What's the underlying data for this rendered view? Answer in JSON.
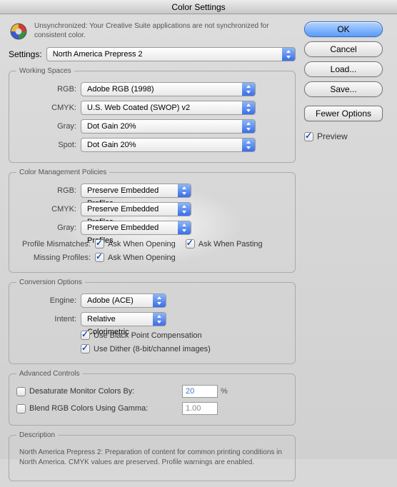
{
  "title": "Color Settings",
  "sync_msg": "Unsynchronized: Your Creative Suite applications are not synchronized for consistent color.",
  "settings_label": "Settings:",
  "settings_preset": "North America Prepress 2",
  "working_spaces": {
    "legend": "Working Spaces",
    "rgb_label": "RGB:",
    "rgb_value": "Adobe RGB (1998)",
    "cmyk_label": "CMYK:",
    "cmyk_value": "U.S. Web Coated (SWOP) v2",
    "gray_label": "Gray:",
    "gray_value": "Dot Gain 20%",
    "spot_label": "Spot:",
    "spot_value": "Dot Gain 20%"
  },
  "policies": {
    "legend": "Color Management Policies",
    "rgb_label": "RGB:",
    "rgb_value": "Preserve Embedded Profiles",
    "cmyk_label": "CMYK:",
    "cmyk_value": "Preserve Embedded Profiles",
    "gray_label": "Gray:",
    "gray_value": "Preserve Embedded Profiles",
    "mismatch_label": "Profile Mismatches:",
    "mismatch_open": "Ask When Opening",
    "mismatch_paste": "Ask When Pasting",
    "missing_label": "Missing Profiles:",
    "missing_open": "Ask When Opening"
  },
  "conversion": {
    "legend": "Conversion Options",
    "engine_label": "Engine:",
    "engine_value": "Adobe (ACE)",
    "intent_label": "Intent:",
    "intent_value": "Relative Colorimetric",
    "bpc": "Use Black Point Compensation",
    "dither": "Use Dither (8-bit/channel images)"
  },
  "advanced": {
    "legend": "Advanced Controls",
    "desat_label": "Desaturate Monitor Colors By:",
    "desat_value": "20",
    "desat_unit": "%",
    "blend_label": "Blend RGB Colors Using Gamma:",
    "blend_value": "1.00"
  },
  "description": {
    "legend": "Description",
    "text": "North America Prepress 2:  Preparation of content for common printing conditions in North America. CMYK values are preserved. Profile warnings are enabled."
  },
  "buttons": {
    "ok": "OK",
    "cancel": "Cancel",
    "load": "Load...",
    "save": "Save...",
    "fewer": "Fewer Options",
    "preview": "Preview"
  }
}
